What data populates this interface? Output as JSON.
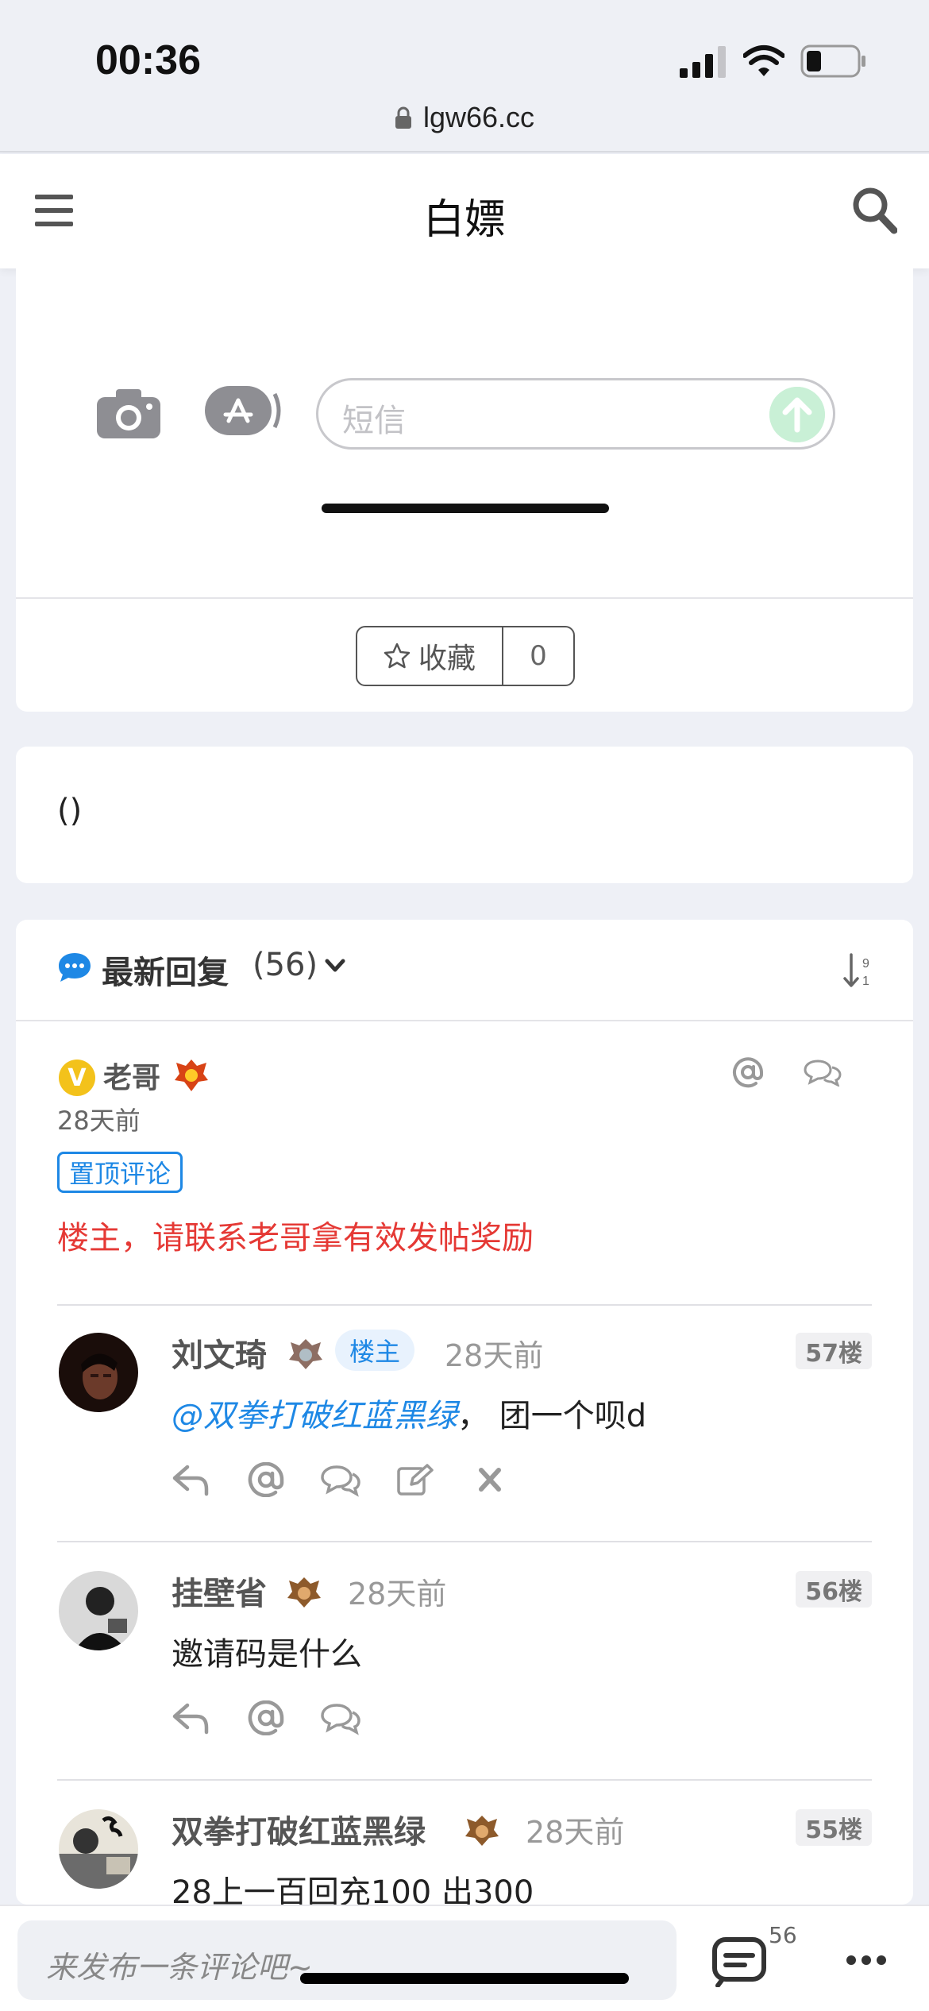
{
  "status_bar": {
    "time": "00:36",
    "url": "lgw66.cc"
  },
  "nav": {
    "title": "白嫖"
  },
  "embed": {
    "message_placeholder": "短信"
  },
  "favorite": {
    "label": "收藏",
    "count": "0"
  },
  "paren_block": {
    "text": "()"
  },
  "replies": {
    "title": "最新回复",
    "count": "(56)",
    "pinned": {
      "vip_badge": "V",
      "name": "老哥",
      "time": "28天前",
      "tag": "置顶评论",
      "content": "楼主，请联系老哥拿有效发帖奖励"
    },
    "comments": [
      {
        "name": "刘文琦",
        "host_tag": "楼主",
        "time": "28天前",
        "floor": "57楼",
        "mention": "@双拳打破红蓝黑绿",
        "content": "，  团一个呗d"
      },
      {
        "name": "挂壁省",
        "time": "28天前",
        "floor": "56楼",
        "content": "邀请码是什么"
      },
      {
        "name": "双拳打破红蓝黑绿",
        "time": "28天前",
        "floor": "55楼",
        "content": "28上一百回充100 出300"
      }
    ]
  },
  "bottom_bar": {
    "placeholder": "来发布一条评论吧~",
    "comment_count": "56"
  },
  "colors": {
    "accent_blue": "#1e88e5",
    "pinned_red": "#e53935",
    "vip_gold": "#f3c21b"
  }
}
